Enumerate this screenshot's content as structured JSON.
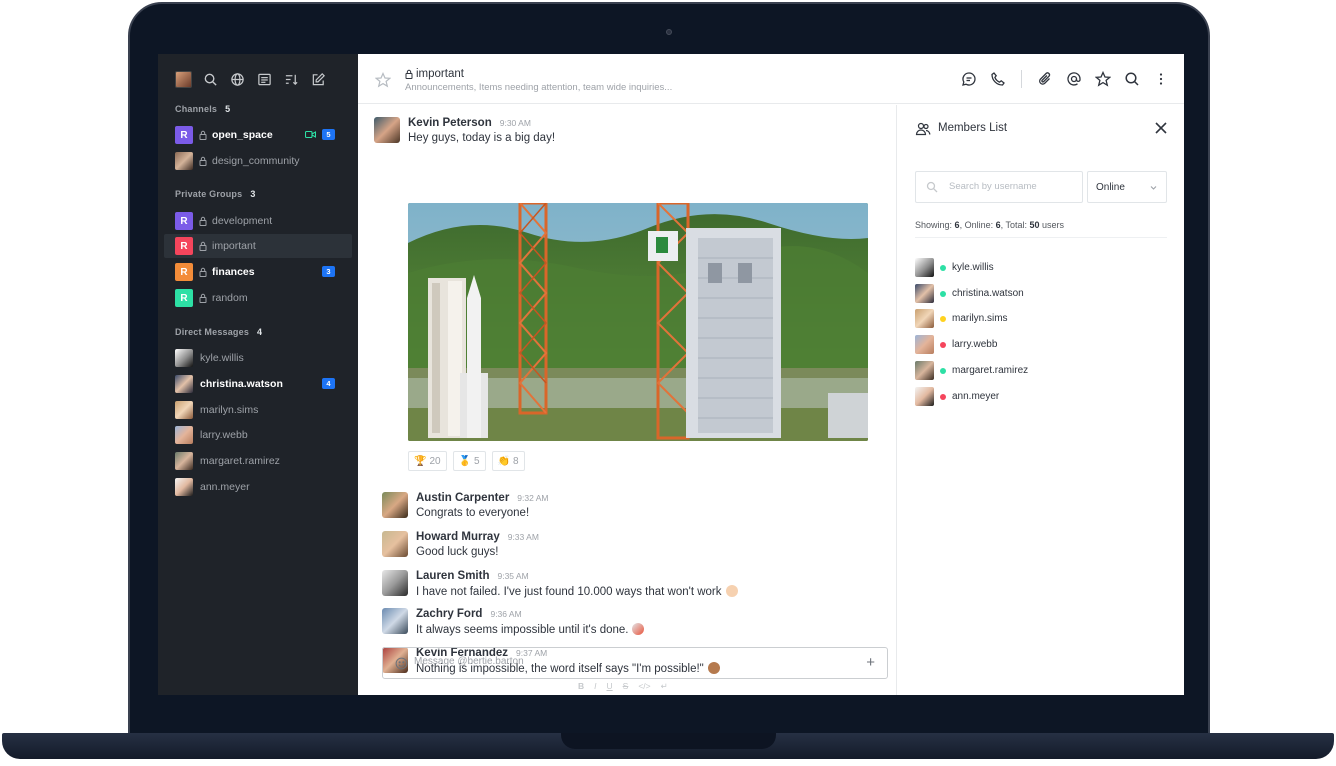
{
  "colors": {
    "online": "#2de0a5",
    "away": "#ffd21f",
    "busy": "#f5455c",
    "badge": "#1d74f5",
    "sidebar": "#1f2329"
  },
  "toolbar": {
    "icons": [
      "search-icon",
      "directory-icon",
      "list-view-icon",
      "sort-icon",
      "edit-icon"
    ]
  },
  "sidebar": {
    "channels": {
      "title": "Channels",
      "count": "5",
      "items": [
        {
          "letter": "R",
          "color": "#7b5be8",
          "label": "open_space",
          "badge": "5",
          "bold": true
        },
        {
          "letter": "",
          "color": "",
          "label": "design_community",
          "badge": "",
          "bold": false
        }
      ]
    },
    "groups": {
      "title": "Private Groups",
      "count": "3",
      "items": [
        {
          "letter": "R",
          "color": "#7b5be8",
          "label": "development",
          "badge": ""
        },
        {
          "letter": "R",
          "color": "#f5455c",
          "label": "important",
          "badge": ""
        },
        {
          "letter": "R",
          "color": "#f38c39",
          "label": "finances",
          "badge": "3"
        },
        {
          "letter": "R",
          "color": "#2de0a5",
          "label": "random",
          "badge": ""
        }
      ]
    },
    "dms": {
      "title": "Direct Messages",
      "count": "4",
      "items": [
        {
          "label": "kyle.willis",
          "badge": ""
        },
        {
          "label": "christina.watson",
          "badge": "4"
        },
        {
          "label": "marilyn.sims",
          "badge": ""
        },
        {
          "label": "larry.webb",
          "badge": ""
        },
        {
          "label": "margaret.ramirez",
          "badge": ""
        },
        {
          "label": "ann.meyer",
          "badge": ""
        }
      ]
    }
  },
  "header": {
    "title": "important",
    "topic": "Announcements, Items needing attention, team wide inquiries...",
    "icons": [
      "discussion-icon",
      "call-icon",
      "attachment-icon",
      "mention-icon",
      "star-icon",
      "search-icon",
      "kebab-icon"
    ]
  },
  "messages": [
    {
      "user": "Kevin Peterson",
      "time": "9:30 AM",
      "text": "Hey guys, today is a big day!"
    },
    {
      "user": "Austin Carpenter",
      "time": "9:32 AM",
      "text": "Congrats to everyone!"
    },
    {
      "user": "Howard Murray",
      "time": "9:33 AM",
      "text": "Good luck guys!"
    },
    {
      "user": "Lauren Smith",
      "time": "9:35 AM",
      "text": "I have not failed. I've just found 10.000 ways that won't work"
    },
    {
      "user": "Zachry Ford",
      "time": "9:36 AM",
      "text": "It always seems impossible until it's done."
    },
    {
      "user": "Kevin Fernandez",
      "time": "9:37 AM",
      "text": "Nothing is impossible, the word itself says \"I'm possible!\""
    }
  ],
  "reactions": [
    {
      "emoji": "🏆",
      "count": "20"
    },
    {
      "emoji": "🥇",
      "count": "5"
    },
    {
      "emoji": "👏",
      "count": "8"
    }
  ],
  "composer": {
    "placeholder": "Message @bertie.barton",
    "format": [
      "B",
      "I",
      "U",
      "S",
      "</>",
      "↵"
    ]
  },
  "members": {
    "title": "Members List",
    "search_placeholder": "Search by username",
    "filter": "Online",
    "showing_label": "Showing:",
    "showing": "6",
    "online_label": "Online:",
    "online": "6",
    "total_label": "Total:",
    "total": "50",
    "users_label": "users",
    "list": [
      {
        "name": "kyle.willis",
        "status": "online"
      },
      {
        "name": "christina.watson",
        "status": "online"
      },
      {
        "name": "marilyn.sims",
        "status": "away"
      },
      {
        "name": "larry.webb",
        "status": "busy"
      },
      {
        "name": "margaret.ramirez",
        "status": "online"
      },
      {
        "name": "ann.meyer",
        "status": "busy"
      }
    ]
  }
}
